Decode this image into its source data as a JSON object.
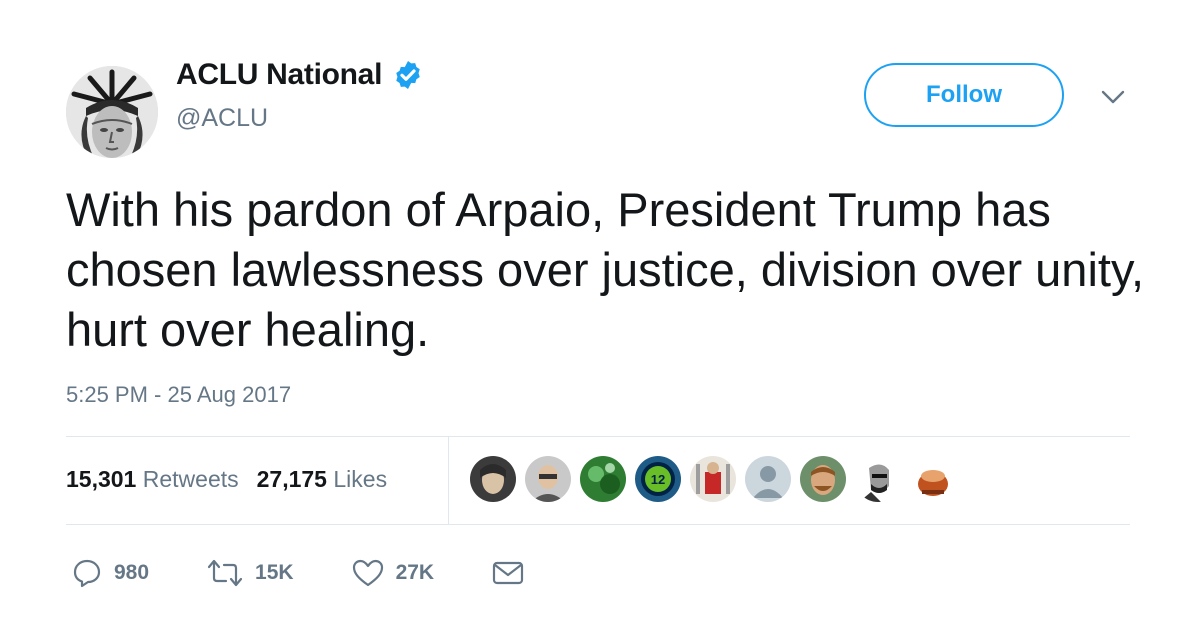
{
  "account": {
    "display_name": "ACLU National",
    "handle": "@ACLU",
    "verified_icon": "verified-badge-icon",
    "verified_color": "#1da1f2"
  },
  "follow_label": "Follow",
  "tweet_text": "With his pardon of Arpaio, President Trump has chosen lawlessness over justice, division over unity, hurt over healing.",
  "timestamp": "5:25 PM - 25 Aug 2017",
  "stats": {
    "retweets_count": "15,301",
    "retweets_label": "Retweets",
    "likes_count": "27,175",
    "likes_label": "Likes"
  },
  "liker_avatars": [
    "liker-avatar-1",
    "liker-avatar-2",
    "liker-avatar-3",
    "liker-avatar-4",
    "liker-avatar-5",
    "liker-avatar-6",
    "liker-avatar-7",
    "liker-avatar-8",
    "liker-avatar-9"
  ],
  "liker_badge_text": "12",
  "actions": {
    "reply_count": "980",
    "retweet_count": "15K",
    "like_count": "27K"
  },
  "colors": {
    "accent": "#1da1f2",
    "text": "#14171a",
    "muted": "#657786",
    "divider": "#e1e8ed"
  }
}
